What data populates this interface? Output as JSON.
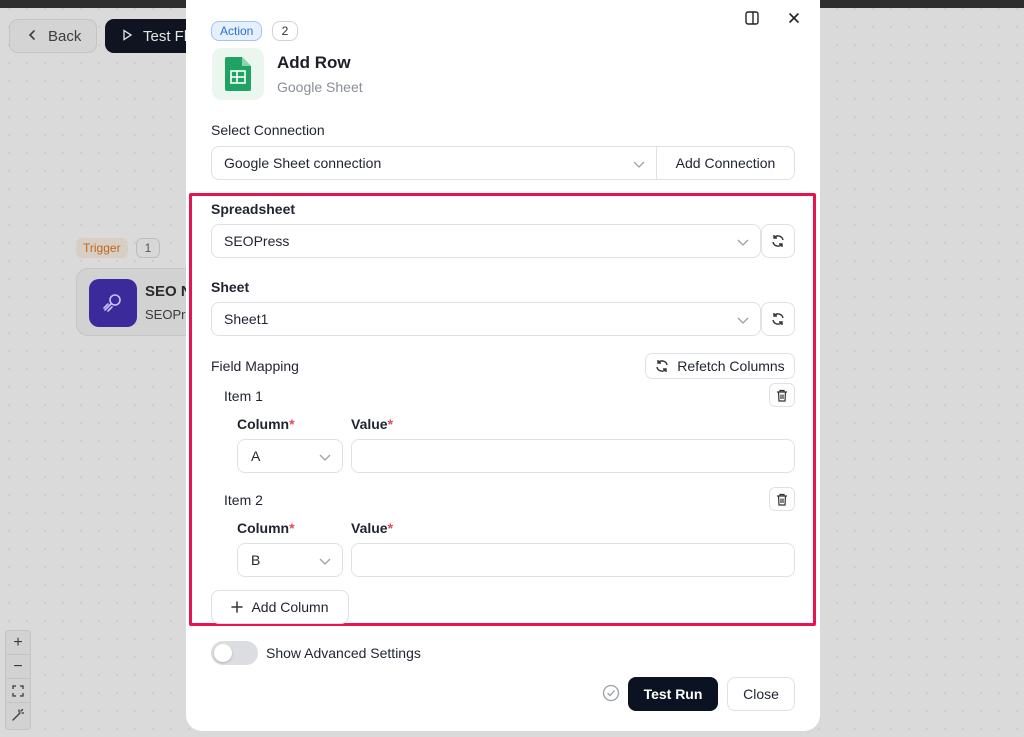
{
  "background": {
    "back_label": "Back",
    "test_flow_label": "Test Fl",
    "trigger_badge": "Trigger",
    "trigger_count": "1",
    "node_title": "SEO N",
    "node_sub": "SEOPr",
    "zoom": {
      "in": "+",
      "out": "−"
    }
  },
  "modal": {
    "action_badge": "Action",
    "action_count": "2",
    "title": "Add Row",
    "app_name": "Google Sheet",
    "select_connection_label": "Select Connection",
    "connection_value": "Google Sheet connection",
    "add_connection_label": "Add Connection",
    "spreadsheet_label": "Spreadsheet",
    "spreadsheet_value": "SEOPress",
    "sheet_label": "Sheet",
    "sheet_value": "Sheet1",
    "field_mapping_label": "Field Mapping",
    "refetch_label": "Refetch Columns",
    "items": [
      {
        "label": "Item 1",
        "column_label": "Column",
        "value_label": "Value",
        "column_value": "A",
        "value": ""
      },
      {
        "label": "Item 2",
        "column_label": "Column",
        "value_label": "Value",
        "column_value": "B",
        "value": ""
      }
    ],
    "required_mark": "*",
    "add_column_label": "Add Column",
    "advanced_label": "Show Advanced Settings",
    "test_run_label": "Test Run",
    "close_label": "Close"
  },
  "colors": {
    "highlight": "#e8144f",
    "primary_button": "#0b1221",
    "action_badge": "#2a6fd6",
    "sheets_green": "#1ea362"
  },
  "icons": [
    "chevron-left-icon",
    "play-icon",
    "panel-icon",
    "close-icon",
    "google-sheets-icon",
    "chevron-down-icon",
    "refresh-icon",
    "trash-icon",
    "plus-icon",
    "check-circle-icon",
    "plug-icon",
    "fit-view-icon",
    "magic-icon"
  ]
}
